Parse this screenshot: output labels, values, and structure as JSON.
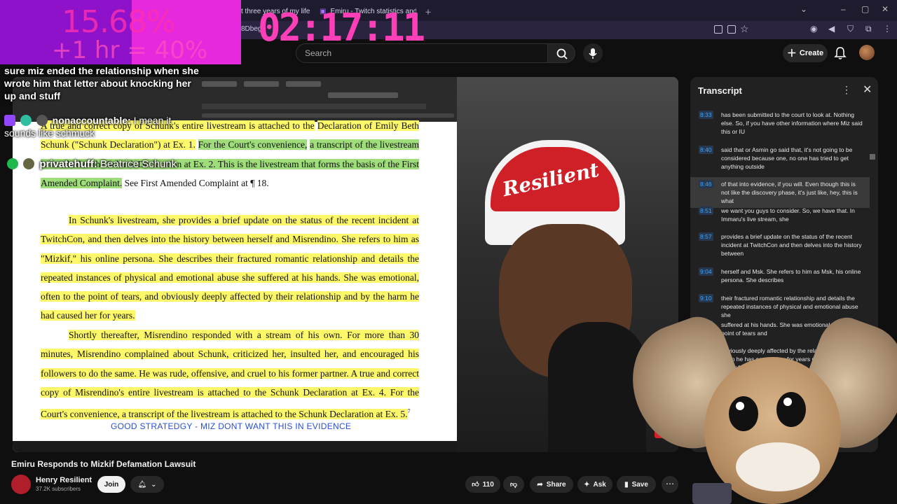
{
  "browser": {
    "tabs": [
      {
        "label": "t three years of my life ["
      },
      {
        "label": "Emiru - Twitch statistics and a"
      }
    ],
    "address_partial": "8Dbeg"
  },
  "stream_overlay": {
    "percentage": "15.68%",
    "hour_goal": "+1 hr = 40%",
    "timer": "02:17:11",
    "chat": [
      {
        "user": "",
        "text": "sure miz ended the relationship when she wrote him that letter about knocking her up and stuff"
      },
      {
        "user": "nonaccountable:",
        "text": "I mean it sounds like schmuck"
      },
      {
        "user": "privatehuff:",
        "text": "Beatrice Schunk"
      }
    ]
  },
  "youtube_header": {
    "search_placeholder": "Search",
    "create_label": "Create"
  },
  "document": {
    "line_fragment_top": "A true and correct copy of Schunk's entire livestream is attached to the",
    "paragraph1_a": "Declaration of Emily Beth Schunk (\"Schunk Declaration\") at Ex. 1.",
    "paragraph1_b": "For the Court's convenience,",
    "paragraph1_c": "a transcript of the livestream is attached to the Schunk Declaration at Ex. 2. This is the livestream that forms the basis of the First Amended Complaint.",
    "paragraph1_d": "See First Amended Complaint at ¶ 18.",
    "paragraph2": "In Schunk's livestream, she provides a brief update on the status of the recent incident at TwitchCon, and then delves into the history between herself and Misrendino. She refers to him as \"Mizkif,\" his online persona. She describes their fractured romantic relationship and details the repeated instances of physical and emotional abuse she suffered at his hands. She was emotional, often to the point of tears, and obviously deeply affected by their relationship and by the harm he had caused her for years.",
    "paragraph3": "Shortly thereafter, Misrendino responded with a stream of his own. For more than 30 minutes, Misrendino complained about Schunk, criticized her, insulted her, and encouraged his followers to do the same. He was rude, offensive, and cruel to his former partner. A true and correct copy of Misrendino's entire livestream is attached to the Schunk Declaration at Ex. 4. For the Court's convenience, a transcript of the livestream is attached to the Schunk Declaration at Ex. 5.",
    "footnote_mark": "7",
    "caption": "GOOD STRATEDGY - MIZ DONT WANT THIS IN EVIDENCE"
  },
  "webcam": {
    "cap_text": "Resilient"
  },
  "transcript": {
    "title": "Transcript",
    "segments": [
      {
        "time": "8:33",
        "text": "has been submitted to the court to look at. Nothing else. So, if you have other information where Miz said this or IU"
      },
      {
        "time": "8:40",
        "text": "said that or Asmin go said that, it's not going to be considered because one, no one has tried to get anything outside"
      },
      {
        "time": "8:46",
        "text": "of that into evidence, if you will. Even though this is not like the discovery phase, it's just like, hey, this is what",
        "active": true
      },
      {
        "time": "8:51",
        "text": "we want you guys to consider. So, we have that. In Immaru's live stream, she"
      },
      {
        "time": "8:57",
        "text": "provides a brief update on the status of the recent incident at TwitchCon and then delves into the history between"
      },
      {
        "time": "9:04",
        "text": "herself and Msk. She refers to him as Msk, his online persona. She describes"
      },
      {
        "time": "9:10",
        "text": "their fractured romantic relationship and details the repeated instances of physical and emotional abuse she"
      },
      {
        "time": "9:18",
        "text": "suffered at his hands. She was emotional often to the point of tears and"
      },
      {
        "time": "9:23",
        "text": "obviously deeply affected by the relationship by the harm he has caused her for years now. Shortly thereafter,"
      }
    ]
  },
  "video_info": {
    "title": "Emiru Responds to Mizkif Defamation Lawsuit",
    "channel": "Henry Resilient",
    "subscribers": "37.2K subscribers",
    "join_label": "Join",
    "likes": "110",
    "share_label": "Share",
    "ask_label": "Ask",
    "save_label": "Save"
  },
  "colors": {
    "overlay_purple": "#8e12c9",
    "overlay_pink": "#f62ee0",
    "timer_pink": "#ff3fb8",
    "highlight_yellow": "#fdf76a",
    "highlight_green": "#9fdc7a",
    "caption_blue": "#2a4fd1",
    "timestamp_blue": "#3ea6ff"
  },
  "icons": [
    "search-icon",
    "mic-icon",
    "plus-icon",
    "bell-icon",
    "thumbs-up-icon",
    "thumbs-down-icon",
    "share-icon",
    "sparkle-icon",
    "bookmark-icon",
    "more-icon",
    "close-icon",
    "kebab-icon"
  ]
}
